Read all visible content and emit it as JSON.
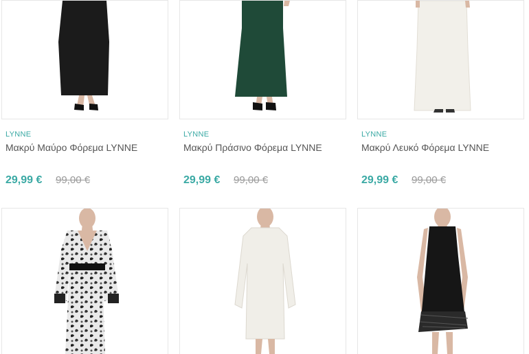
{
  "products": [
    {
      "brand": "LYNNE",
      "title": "Μακρύ Μαύρο Φόρεμα LYNNE",
      "price": "29,99 €",
      "old_price": "99,00 €"
    },
    {
      "brand": "LYNNE",
      "title": "Μακρύ Πράσινο Φόρεμα LYNNE",
      "price": "29,99 €",
      "old_price": "99,00 €"
    },
    {
      "brand": "LYNNE",
      "title": "Μακρύ Λευκό Φόρεμα LYNNE",
      "price": "29,99 €",
      "old_price": "99,00 €"
    }
  ],
  "colors": {
    "accent": "#3aa9a4",
    "border": "#e6e6e6"
  }
}
